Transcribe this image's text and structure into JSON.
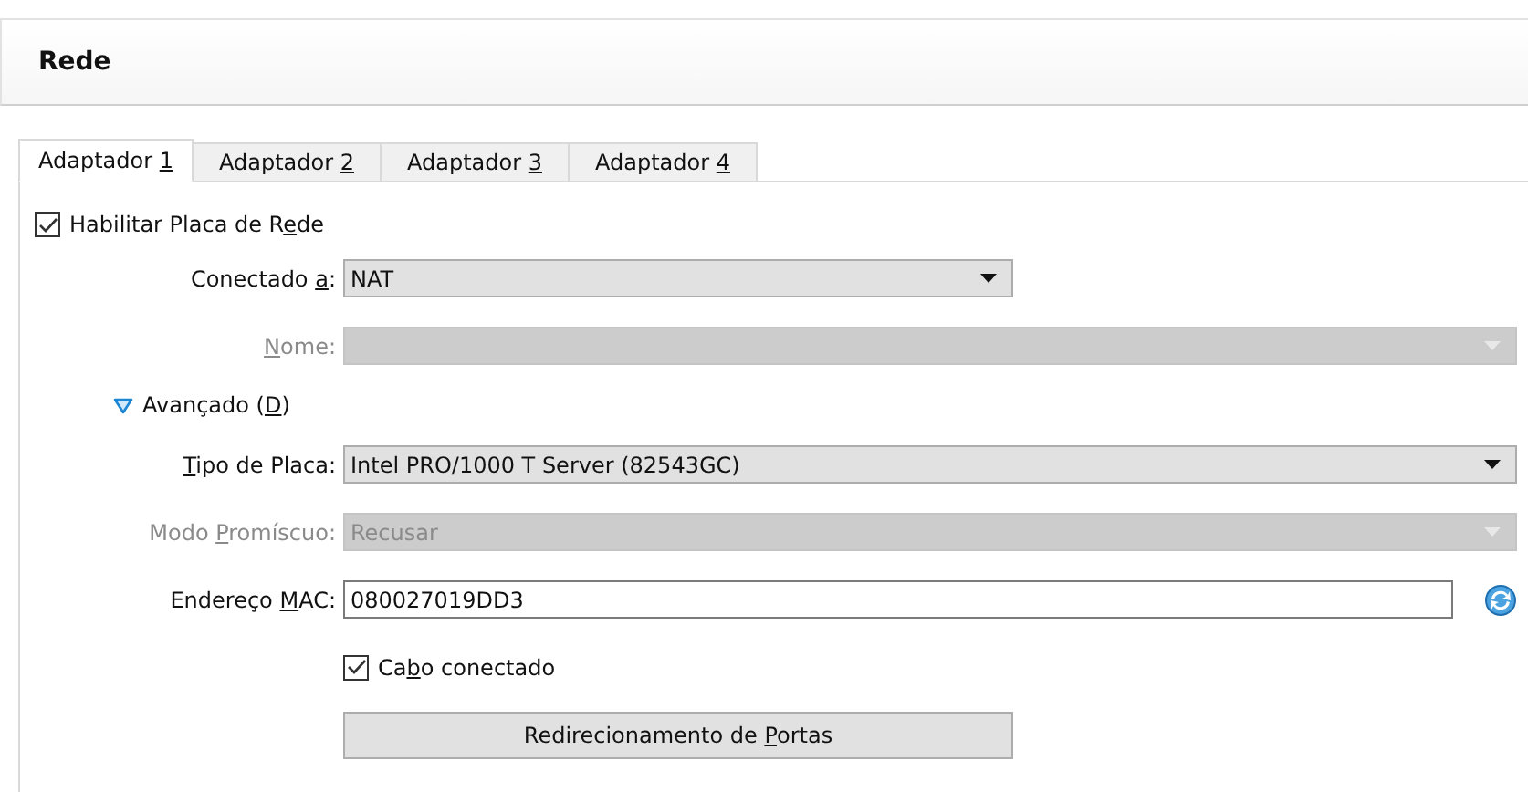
{
  "section": {
    "title": "Rede"
  },
  "tabs": [
    {
      "label": [
        {
          "text": "Adaptador "
        },
        {
          "text": "1",
          "underlined": true
        }
      ],
      "selected": true
    },
    {
      "label": [
        {
          "text": "Adaptador "
        },
        {
          "text": "2",
          "underlined": true
        }
      ],
      "selected": false
    },
    {
      "label": [
        {
          "text": "Adaptador "
        },
        {
          "text": "3",
          "underlined": true
        }
      ],
      "selected": false
    },
    {
      "label": [
        {
          "text": "Adaptador "
        },
        {
          "text": "4",
          "underlined": true
        }
      ],
      "selected": false
    }
  ],
  "enable_adapter": {
    "label": [
      {
        "text": "Habilitar Placa de R"
      },
      {
        "text": "e",
        "underlined": true
      },
      {
        "text": "de"
      }
    ],
    "checked": true
  },
  "basic_fields": [
    {
      "kind": "dropdown",
      "label": [
        {
          "text": "Conectado "
        },
        {
          "text": "a",
          "underlined": true
        },
        {
          "text": ":"
        }
      ],
      "value": "NAT",
      "disabled": false,
      "wide": false
    },
    {
      "kind": "dropdown",
      "label": [
        {
          "text": "N",
          "underlined": true
        },
        {
          "text": "ome:"
        }
      ],
      "disabled": true,
      "wide": true
    }
  ],
  "advanced": {
    "label": [
      {
        "text": "Avançado ("
      },
      {
        "text": "D",
        "underlined": true
      },
      {
        "text": ")"
      }
    ],
    "expanded": true
  },
  "advanced_fields": [
    {
      "kind": "dropdown",
      "label": [
        {
          "text": "T",
          "underlined": true
        },
        {
          "text": "ipo de Placa:"
        }
      ],
      "value": "Intel PRO/1000 T Server (82543GC)",
      "disabled": false,
      "wide": true
    },
    {
      "kind": "dropdown",
      "label": [
        {
          "text": "Modo "
        },
        {
          "text": "P",
          "underlined": true
        },
        {
          "text": "romíscuo:"
        }
      ],
      "value": "Recusar",
      "disabled": true,
      "wide": true
    },
    {
      "kind": "text",
      "label": [
        {
          "text": "Endereço "
        },
        {
          "text": "M",
          "underlined": true
        },
        {
          "text": "AC:"
        }
      ],
      "value": "080027019DD3",
      "disabled": false
    }
  ],
  "cable_connected": {
    "label": [
      {
        "text": "Ca"
      },
      {
        "text": "b",
        "underlined": true
      },
      {
        "text": "o conectado"
      }
    ],
    "checked": true
  },
  "port_forwarding_button": {
    "label": [
      {
        "text": "Redirecionamento de "
      },
      {
        "text": "P",
        "underlined": true
      },
      {
        "text": "ortas"
      }
    ]
  }
}
